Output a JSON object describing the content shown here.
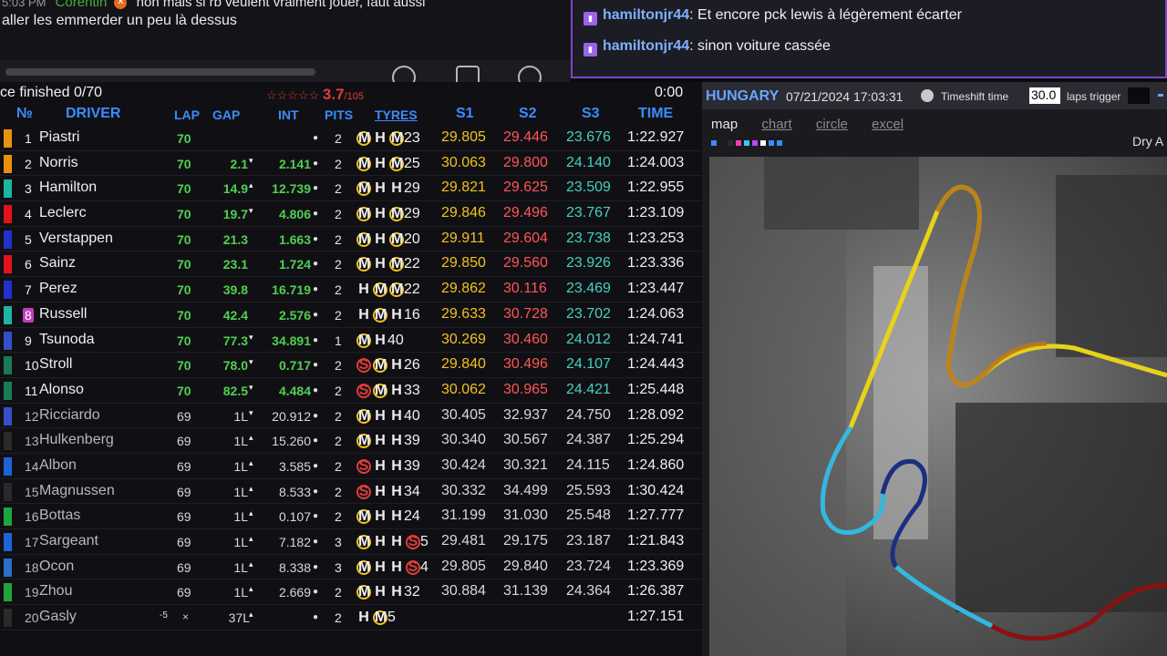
{
  "chat_left": {
    "time": "5:03 PM",
    "username": "Corentin",
    "message_partial": "non mais si rb veulent vraiment jouer, faut aussi",
    "message_line2": "aller les emmerder un peu là dessus"
  },
  "chat_right": {
    "messages": [
      {
        "user": "hamiltonjr44",
        "text": ": Et encore pck lewis à légèrement écarter"
      },
      {
        "user": "hamiltonjr44",
        "text": ": sinon voiture cassée"
      }
    ]
  },
  "timing": {
    "status": "ce finished  0/70",
    "rating": "3.7",
    "rating_of": "/105",
    "clock": "0:00",
    "headers": {
      "num": "№",
      "driver": "DRIVER",
      "lap": "LAP",
      "gap": "GAP",
      "int": "INT",
      "pits": "PITS",
      "tyres": "TYRES",
      "s1": "S1",
      "s2": "S2",
      "s3": "S3",
      "time": "TIME"
    },
    "rows": [
      {
        "pos": "1",
        "driver": "Piastri",
        "team": "#e8910f",
        "lap": "70",
        "gap": "",
        "arrow": "",
        "int": "",
        "pits": "2",
        "tyres": [
          [
            "M",
            ""
          ],
          [
            "H",
            ""
          ],
          [
            "M",
            "23"
          ]
        ],
        "s1": "29.805",
        "s1c": "y",
        "s2": "29.446",
        "s2c": "r",
        "s3": "23.676",
        "s3c": "g",
        "time": "1:22.927"
      },
      {
        "pos": "2",
        "driver": "Norris",
        "team": "#e8910f",
        "lap": "70",
        "gap": "2.1",
        "arrow": "▾",
        "int": "2.141",
        "pits": "2",
        "tyres": [
          [
            "M",
            ""
          ],
          [
            "H",
            ""
          ],
          [
            "M",
            "25"
          ]
        ],
        "s1": "30.063",
        "s1c": "y",
        "s2": "29.800",
        "s2c": "r",
        "s3": "24.140",
        "s3c": "g",
        "time": "1:24.003"
      },
      {
        "pos": "3",
        "driver": "Hamilton",
        "team": "#1fb5a0",
        "lap": "70",
        "gap": "14.9",
        "arrow": "▴",
        "int": "12.739",
        "pits": "2",
        "tyres": [
          [
            "M",
            ""
          ],
          [
            "H",
            ""
          ],
          [
            "H",
            "29"
          ]
        ],
        "s1": "29.821",
        "s1c": "y",
        "s2": "29.625",
        "s2c": "r",
        "s3": "23.509",
        "s3c": "g",
        "time": "1:22.955"
      },
      {
        "pos": "4",
        "driver": "Leclerc",
        "team": "#e3121b",
        "lap": "70",
        "gap": "19.7",
        "arrow": "▾",
        "int": "4.806",
        "pits": "2",
        "tyres": [
          [
            "M",
            ""
          ],
          [
            "H",
            ""
          ],
          [
            "M",
            "29"
          ]
        ],
        "s1": "29.846",
        "s1c": "y",
        "s2": "29.496",
        "s2c": "r",
        "s3": "23.767",
        "s3c": "g",
        "time": "1:23.109"
      },
      {
        "pos": "5",
        "driver": "Verstappen",
        "team": "#2430c9",
        "lap": "70",
        "gap": "21.3",
        "arrow": "",
        "int": "1.663",
        "pits": "2",
        "tyres": [
          [
            "M",
            ""
          ],
          [
            "H",
            ""
          ],
          [
            "M",
            "20"
          ]
        ],
        "s1": "29.911",
        "s1c": "y",
        "s2": "29.604",
        "s2c": "r",
        "s3": "23.738",
        "s3c": "g",
        "time": "1:23.253"
      },
      {
        "pos": "6",
        "driver": "Sainz",
        "team": "#e3121b",
        "lap": "70",
        "gap": "23.1",
        "arrow": "",
        "int": "1.724",
        "pits": "2",
        "tyres": [
          [
            "M",
            ""
          ],
          [
            "H",
            ""
          ],
          [
            "M",
            "22"
          ]
        ],
        "s1": "29.850",
        "s1c": "y",
        "s2": "29.560",
        "s2c": "r",
        "s3": "23.926",
        "s3c": "g",
        "time": "1:23.336"
      },
      {
        "pos": "7",
        "driver": "Perez",
        "team": "#2430c9",
        "lap": "70",
        "gap": "39.8",
        "arrow": "",
        "int": "16.719",
        "pits": "2",
        "tyres": [
          [
            "H",
            ""
          ],
          [
            "M",
            ""
          ],
          [
            "M",
            "22"
          ]
        ],
        "s1": "29.862",
        "s1c": "y",
        "s2": "30.116",
        "s2c": "r",
        "s3": "23.469",
        "s3c": "g",
        "time": "1:23.447"
      },
      {
        "pos": "8",
        "driver": "Russell",
        "team": "#1fb5a0",
        "lap": "70",
        "gap": "42.4",
        "arrow": "",
        "int": "2.576",
        "pits": "2",
        "tyres": [
          [
            "H",
            ""
          ],
          [
            "M",
            ""
          ],
          [
            "H",
            "16"
          ]
        ],
        "s1": "29.633",
        "s1c": "y",
        "s2": "30.728",
        "s2c": "r",
        "s3": "23.702",
        "s3c": "g",
        "time": "1:24.063",
        "highlight": true
      },
      {
        "pos": "9",
        "driver": "Tsunoda",
        "team": "#3450c8",
        "lap": "70",
        "gap": "77.3",
        "arrow": "▾",
        "int": "34.891",
        "pits": "1",
        "tyres": [
          [
            "M",
            ""
          ],
          [
            "H",
            "40"
          ]
        ],
        "s1": "30.269",
        "s1c": "y",
        "s2": "30.460",
        "s2c": "r",
        "s3": "24.012",
        "s3c": "g",
        "time": "1:24.741"
      },
      {
        "pos": "10",
        "driver": "Stroll",
        "team": "#1a7a55",
        "lap": "70",
        "gap": "78.0",
        "arrow": "▾",
        "int": "0.717",
        "pits": "2",
        "tyres": [
          [
            "S",
            ""
          ],
          [
            "M",
            ""
          ],
          [
            "H",
            "26"
          ]
        ],
        "s1": "29.840",
        "s1c": "y",
        "s2": "30.496",
        "s2c": "r",
        "s3": "24.107",
        "s3c": "g",
        "time": "1:24.443"
      },
      {
        "pos": "11",
        "driver": "Alonso",
        "team": "#1a7a55",
        "lap": "70",
        "gap": "82.5",
        "arrow": "▾",
        "int": "4.484",
        "pits": "2",
        "tyres": [
          [
            "S",
            ""
          ],
          [
            "M",
            ""
          ],
          [
            "H",
            "33"
          ]
        ],
        "s1": "30.062",
        "s1c": "y",
        "s2": "30.965",
        "s2c": "r",
        "s3": "24.421",
        "s3c": "g",
        "time": "1:25.448"
      },
      {
        "pos": "12",
        "driver": "Ricciardo",
        "team": "#3450c8",
        "lap": "69",
        "gap": "1L",
        "arrow": "▾",
        "int": "20.912",
        "pits": "2",
        "tyres": [
          [
            "M",
            ""
          ],
          [
            "H",
            ""
          ],
          [
            "H",
            "40"
          ]
        ],
        "s1": "30.405",
        "s1c": "w",
        "s2": "32.937",
        "s2c": "w",
        "s3": "24.750",
        "s3c": "w",
        "time": "1:28.092",
        "lapped": true
      },
      {
        "pos": "13",
        "driver": "Hulkenberg",
        "team": "#2a2a2a",
        "lap": "69",
        "gap": "1L",
        "arrow": "▴",
        "int": "15.260",
        "pits": "2",
        "tyres": [
          [
            "M",
            ""
          ],
          [
            "H",
            ""
          ],
          [
            "H",
            "39"
          ]
        ],
        "s1": "30.340",
        "s1c": "w",
        "s2": "30.567",
        "s2c": "w",
        "s3": "24.387",
        "s3c": "w",
        "time": "1:25.294",
        "lapped": true
      },
      {
        "pos": "14",
        "driver": "Albon",
        "team": "#1f63d9",
        "lap": "69",
        "gap": "1L",
        "arrow": "▴",
        "int": "3.585",
        "pits": "2",
        "tyres": [
          [
            "S",
            ""
          ],
          [
            "H",
            ""
          ],
          [
            "H",
            "39"
          ]
        ],
        "s1": "30.424",
        "s1c": "w",
        "s2": "30.321",
        "s2c": "w",
        "s3": "24.115",
        "s3c": "w",
        "time": "1:24.860",
        "lapped": true
      },
      {
        "pos": "15",
        "driver": "Magnussen",
        "team": "#2a2a2a",
        "lap": "69",
        "gap": "1L",
        "arrow": "▴",
        "int": "8.533",
        "pits": "2",
        "tyres": [
          [
            "S",
            ""
          ],
          [
            "H",
            ""
          ],
          [
            "H",
            "34"
          ]
        ],
        "s1": "30.332",
        "s1c": "w",
        "s2": "34.499",
        "s2c": "w",
        "s3": "25.593",
        "s3c": "w",
        "time": "1:30.424",
        "lapped": true
      },
      {
        "pos": "16",
        "driver": "Bottas",
        "team": "#1ea63c",
        "lap": "69",
        "gap": "1L",
        "arrow": "▴",
        "int": "0.107",
        "pits": "2",
        "tyres": [
          [
            "M",
            ""
          ],
          [
            "H",
            ""
          ],
          [
            "H",
            "24"
          ]
        ],
        "s1": "31.199",
        "s1c": "w",
        "s2": "31.030",
        "s2c": "w",
        "s3": "25.548",
        "s3c": "w",
        "time": "1:27.777",
        "lapped": true
      },
      {
        "pos": "17",
        "driver": "Sargeant",
        "team": "#1f63d9",
        "lap": "69",
        "gap": "1L",
        "arrow": "▴",
        "int": "7.182",
        "pits": "3",
        "tyres": [
          [
            "M",
            ""
          ],
          [
            "H",
            ""
          ],
          [
            "H",
            ""
          ],
          [
            "S",
            "5"
          ]
        ],
        "s1": "29.481",
        "s1c": "w",
        "s2": "29.175",
        "s2c": "w",
        "s3": "23.187",
        "s3c": "w",
        "time": "1:21.843",
        "lapped": true
      },
      {
        "pos": "18",
        "driver": "Ocon",
        "team": "#2a6fc8",
        "lap": "69",
        "gap": "1L",
        "arrow": "▴",
        "int": "8.338",
        "pits": "3",
        "tyres": [
          [
            "M",
            ""
          ],
          [
            "H",
            ""
          ],
          [
            "H",
            ""
          ],
          [
            "S",
            "4"
          ]
        ],
        "s1": "29.805",
        "s1c": "w",
        "s2": "29.840",
        "s2c": "w",
        "s3": "23.724",
        "s3c": "w",
        "time": "1:23.369",
        "lapped": true
      },
      {
        "pos": "19",
        "driver": "Zhou",
        "team": "#1ea63c",
        "lap": "69",
        "gap": "1L",
        "arrow": "▴",
        "int": "2.669",
        "pits": "2",
        "tyres": [
          [
            "M",
            ""
          ],
          [
            "H",
            ""
          ],
          [
            "H",
            "32"
          ]
        ],
        "s1": "30.884",
        "s1c": "w",
        "s2": "31.139",
        "s2c": "w",
        "s3": "24.364",
        "s3c": "w",
        "time": "1:26.387",
        "lapped": true
      },
      {
        "pos": "20",
        "driver": "Gasly",
        "team": "#2a2a2a",
        "lap": "-5",
        "gap": "37L",
        "arrow": "▴",
        "int": "",
        "pits": "2",
        "tyres": [
          [
            "H",
            ""
          ],
          [
            "M",
            "5"
          ]
        ],
        "s1": "",
        "s1c": "w",
        "s2": "",
        "s2c": "w",
        "s3": "",
        "s3c": "w",
        "time": "1:27.151",
        "lapped": true,
        "retired": "×"
      }
    ]
  },
  "map_panel": {
    "location": "HUNGARY",
    "datetime": "07/21/2024 17:03:31",
    "timeshift_label": "Timeshift time",
    "timeshift_value": "30.0",
    "laps_trigger_label": "laps trigger",
    "tabs": [
      "map",
      "chart",
      "circle",
      "excel"
    ],
    "active_tab": "map",
    "track_condition": "Dry A",
    "palette": [
      "#3a8cff",
      "#1a1a1f",
      "#2a2a30",
      "#ff3ea5",
      "#36c8ff",
      "#b845ff",
      "#ffffff",
      "#3a8cff",
      "#3a8cff"
    ]
  }
}
